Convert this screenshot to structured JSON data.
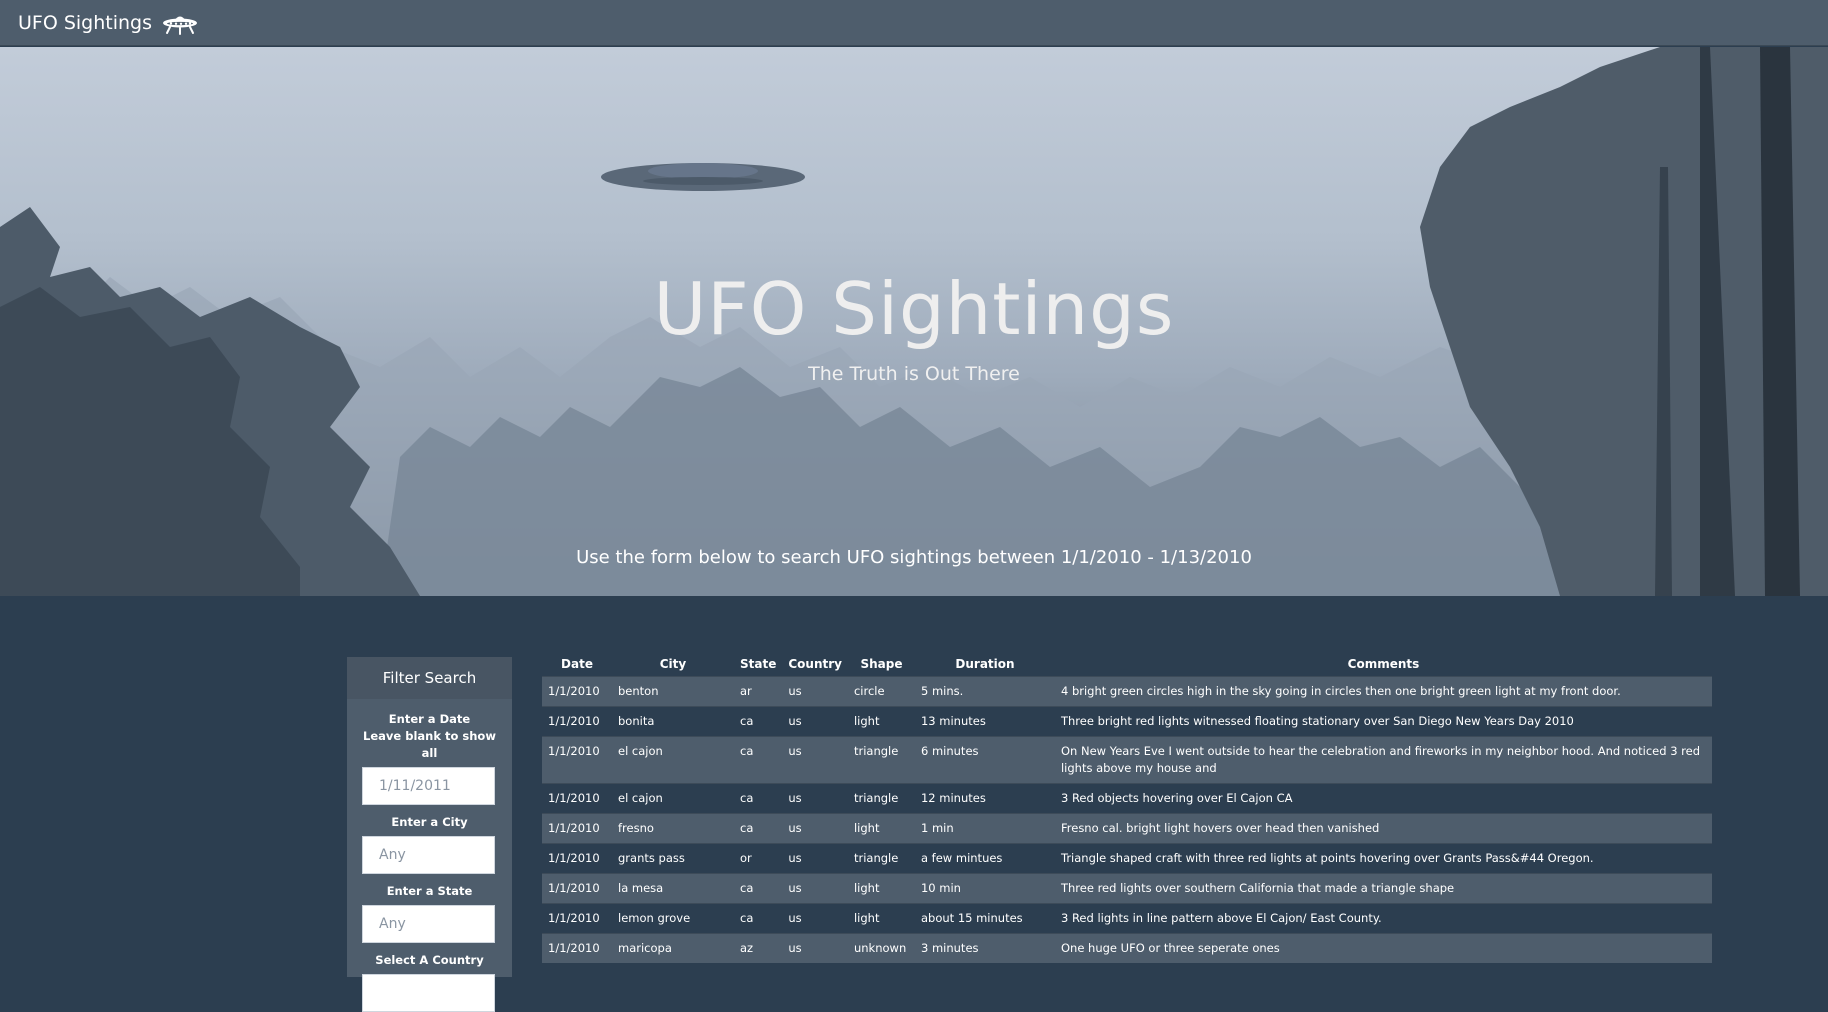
{
  "navbar": {
    "brand": "UFO Sightings",
    "brand_icon": "ufo-icon"
  },
  "hero": {
    "title": "UFO Sightings",
    "subtitle": "The Truth is Out There",
    "lead": "Use the form below to search UFO sightings between 1/1/2010 - 1/13/2010"
  },
  "filter": {
    "heading": "Filter Search",
    "date_label_1": "Enter a Date",
    "date_label_2": "Leave blank to show all",
    "date_placeholder": "1/11/2011",
    "city_label": "Enter a City",
    "city_placeholder": "Any",
    "state_label": "Enter a State",
    "state_placeholder": "Any",
    "country_label": "Select A Country"
  },
  "table": {
    "headers": [
      "Date",
      "City",
      "State",
      "Country",
      "Shape",
      "Duration",
      "Comments"
    ],
    "rows": [
      [
        "1/1/2010",
        "benton",
        "ar",
        "us",
        "circle",
        "5 mins.",
        "4 bright green circles high in the sky going in circles then one bright green light at my front door."
      ],
      [
        "1/1/2010",
        "bonita",
        "ca",
        "us",
        "light",
        "13 minutes",
        "Three bright red lights witnessed floating stationary over San Diego New Years Day 2010"
      ],
      [
        "1/1/2010",
        "el cajon",
        "ca",
        "us",
        "triangle",
        "6 minutes",
        "On New Years Eve I went outside to hear the celebration and fireworks in my neighbor hood. And noticed 3 red lights above my house and"
      ],
      [
        "1/1/2010",
        "el cajon",
        "ca",
        "us",
        "triangle",
        "12 minutes",
        "3 Red objects hovering over El Cajon CA"
      ],
      [
        "1/1/2010",
        "fresno",
        "ca",
        "us",
        "light",
        "1 min",
        "Fresno cal. bright light hovers over head then vanished"
      ],
      [
        "1/1/2010",
        "grants pass",
        "or",
        "us",
        "triangle",
        "a few mintues",
        "Triangle shaped craft with three red lights at points hovering over Grants Pass&#44 Oregon."
      ],
      [
        "1/1/2010",
        "la mesa",
        "ca",
        "us",
        "light",
        "10 min",
        "Three red lights over southern California that made a triangle shape"
      ],
      [
        "1/1/2010",
        "lemon grove",
        "ca",
        "us",
        "light",
        "about 15 minutes",
        "3 Red lights in line pattern above El Cajon/ East County."
      ],
      [
        "1/1/2010",
        "maricopa",
        "az",
        "us",
        "unknown",
        "3 minutes",
        "One huge UFO or three seperate ones"
      ]
    ]
  }
}
